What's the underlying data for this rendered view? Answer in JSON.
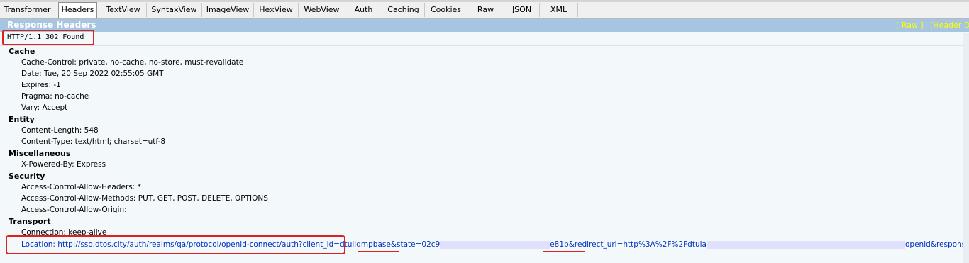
{
  "tabs": [
    "Transformer",
    "Headers",
    "TextView",
    "SyntaxView",
    "ImageView",
    "HexView",
    "WebView",
    "Auth",
    "Caching",
    "Cookies",
    "Raw",
    "JSON",
    "XML"
  ],
  "active_tab": "Headers",
  "header": {
    "title": "Response Headers",
    "raw_link": "[ Raw ]",
    "header_defs_link": "[Header D"
  },
  "status_line": "HTTP/1.1 302 Found",
  "groups": {
    "cache": {
      "title": "Cache",
      "rows": [
        "Cache-Control: private, no-cache, no-store, must-revalidate",
        "Date: Tue, 20 Sep 2022 02:55:05 GMT",
        "Expires: -1",
        "Pragma: no-cache",
        "Vary: Accept"
      ]
    },
    "entity": {
      "title": "Entity",
      "rows": [
        "Content-Length: 548",
        "Content-Type: text/html; charset=utf-8"
      ]
    },
    "misc": {
      "title": "Miscellaneous",
      "rows": [
        "X-Powered-By: Express"
      ]
    },
    "security": {
      "title": "Security",
      "rows": [
        "Access-Control-Allow-Headers: *",
        "Access-Control-Allow-Methods: PUT, GET, POST, DELETE, OPTIONS",
        "Access-Control-Allow-Origin:"
      ]
    },
    "transport": {
      "title": "Transport",
      "rows": [
        "Connection: keep-alive"
      ],
      "location": {
        "part1": "Location: http://sso.dtos.city/auth/realms/qa/protocol/openid-connect/auth?client_id=dtuiidmpbase&state=02c9",
        "part2": "e81b&redirect_uri=http%3A%2F%2Fdtuia",
        "part3": "openid&response_type=code"
      }
    }
  }
}
